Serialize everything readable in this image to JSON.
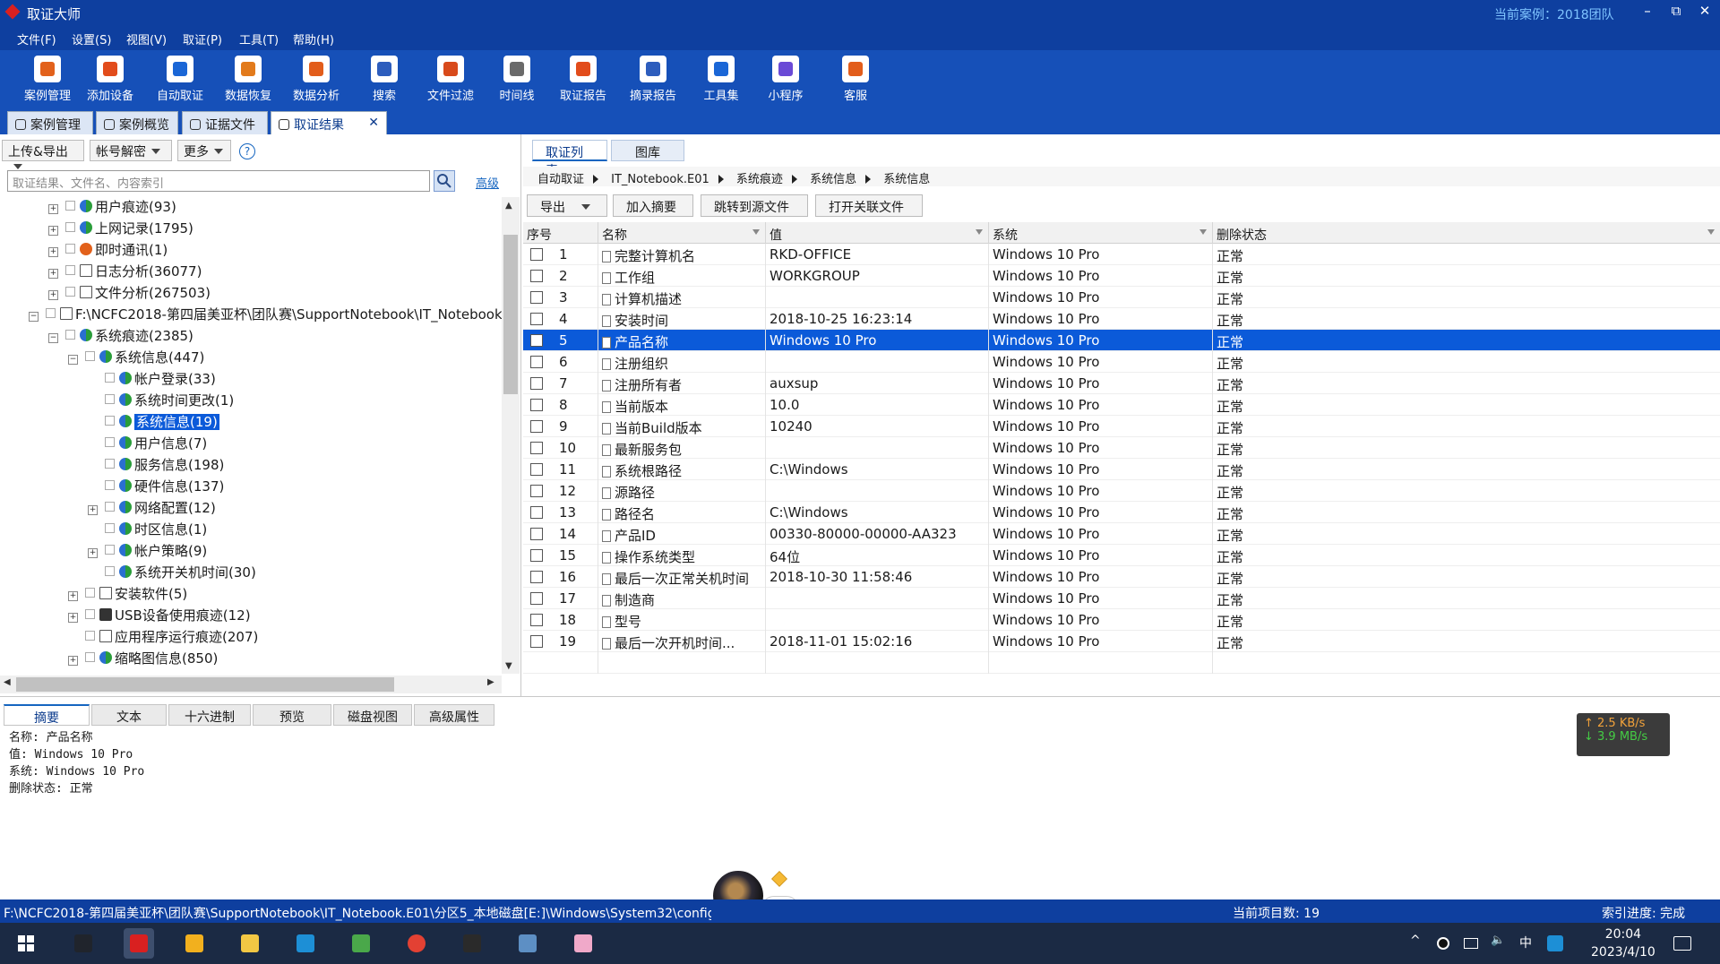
{
  "window": {
    "title": "取证大师",
    "current_case": "当前案例：2018团队",
    "controls": [
      "–",
      "⧉",
      "✕"
    ]
  },
  "menu": [
    "文件(F)",
    "设置(S)",
    "视图(V)",
    "取证(P)",
    "工具(T)",
    "帮助(H)"
  ],
  "toolbar": [
    {
      "label": "案例管理",
      "icon": "case-icon",
      "color": "#e2611b"
    },
    {
      "label": "添加设备",
      "icon": "add-device-icon",
      "color": "#e24c1b"
    },
    {
      "label": "自动取证",
      "icon": "auto-icon",
      "color": "#1a66d6"
    },
    {
      "label": "数据恢复",
      "icon": "recover-icon",
      "color": "#e27a1b"
    },
    {
      "label": "数据分析",
      "icon": "analysis-icon",
      "color": "#e25d1b"
    },
    {
      "label": "搜索",
      "icon": "search-doc-icon",
      "color": "#2d5dbd"
    },
    {
      "label": "文件过滤",
      "icon": "filter-icon",
      "color": "#d84a1b"
    },
    {
      "label": "时间线",
      "icon": "timeline-icon",
      "color": "#6a6a6a"
    },
    {
      "label": "取证报告",
      "icon": "report-icon",
      "color": "#e24c1b"
    },
    {
      "label": "摘录报告",
      "icon": "excerpt-icon",
      "color": "#2d5dbd"
    },
    {
      "label": "工具集",
      "icon": "tools-icon",
      "color": "#1a66d6"
    },
    {
      "label": "小程序",
      "icon": "miniprogram-icon",
      "color": "#6a4ad6"
    },
    {
      "label": "客服",
      "icon": "support-icon",
      "color": "#e25d1b"
    }
  ],
  "tabs": [
    {
      "label": "案例管理",
      "active": false
    },
    {
      "label": "案例概览",
      "active": false
    },
    {
      "label": "证据文件",
      "active": false
    },
    {
      "label": "取证结果",
      "active": true,
      "close": "✕"
    }
  ],
  "left": {
    "buttons": [
      "上传&导出",
      "帐号解密",
      "更多",
      "?"
    ],
    "search_placeholder": "取证结果、文件名、内容索引",
    "advanced": "高级",
    "tree": [
      {
        "label": "用户痕迹(93)",
        "level": 0,
        "exp": "+",
        "icon": "green"
      },
      {
        "label": "上网记录(1795)",
        "level": 0,
        "exp": "+",
        "icon": "globe"
      },
      {
        "label": "即时通讯(1)",
        "level": 0,
        "exp": "+",
        "icon": "chat"
      },
      {
        "label": "日志分析(36077)",
        "level": 0,
        "exp": "+",
        "icon": "doc"
      },
      {
        "label": "文件分析(267503)",
        "level": 0,
        "exp": "+",
        "icon": "doc"
      },
      {
        "label": "F:\\NCFC2018-第四届美亚杯\\团队赛\\SupportNotebook\\IT_Notebook.E01",
        "level": -1,
        "exp": "−",
        "icon": "doc"
      },
      {
        "label": "系统痕迹(2385)",
        "level": 0,
        "exp": "−",
        "icon": "green"
      },
      {
        "label": "系统信息(447)",
        "level": 1,
        "exp": "−",
        "icon": "green"
      },
      {
        "label": "帐户登录(33)",
        "level": 2,
        "exp": "",
        "icon": "green"
      },
      {
        "label": "系统时间更改(1)",
        "level": 2,
        "exp": "",
        "icon": "green"
      },
      {
        "label": "系统信息(19)",
        "level": 2,
        "exp": "",
        "icon": "green",
        "selected": true
      },
      {
        "label": "用户信息(7)",
        "level": 2,
        "exp": "",
        "icon": "green"
      },
      {
        "label": "服务信息(198)",
        "level": 2,
        "exp": "",
        "icon": "green"
      },
      {
        "label": "硬件信息(137)",
        "level": 2,
        "exp": "",
        "icon": "green"
      },
      {
        "label": "网络配置(12)",
        "level": 2,
        "exp": "+",
        "icon": "green"
      },
      {
        "label": "时区信息(1)",
        "level": 2,
        "exp": "",
        "icon": "green"
      },
      {
        "label": "帐户策略(9)",
        "level": 2,
        "exp": "+",
        "icon": "green"
      },
      {
        "label": "系统开关机时间(30)",
        "level": 2,
        "exp": "",
        "icon": "green"
      },
      {
        "label": "安装软件(5)",
        "level": 1,
        "exp": "+",
        "icon": "doc"
      },
      {
        "label": "USB设备使用痕迹(12)",
        "level": 1,
        "exp": "+",
        "icon": "usb"
      },
      {
        "label": "应用程序运行痕迹(207)",
        "level": 1,
        "exp": "",
        "icon": "doc"
      },
      {
        "label": "缩略图信息(850)",
        "level": 1,
        "exp": "+",
        "icon": "green"
      }
    ]
  },
  "right": {
    "tabs": [
      "取证列表",
      "图库"
    ],
    "breadcrumb": [
      "自动取证",
      "IT_Notebook.E01",
      "系统痕迹",
      "系统信息",
      "系统信息"
    ],
    "buttons": [
      "导出",
      "加入摘要",
      "跳转到源文件",
      "打开关联文件"
    ],
    "columns": [
      "序号",
      "名称",
      "值",
      "系统",
      "删除状态"
    ],
    "rows": [
      {
        "n": "1",
        "name": "完整计算机名",
        "value": "RKD-OFFICE",
        "sys": "Windows 10 Pro",
        "del": "正常"
      },
      {
        "n": "2",
        "name": "工作组",
        "value": "WORKGROUP",
        "sys": "Windows 10 Pro",
        "del": "正常"
      },
      {
        "n": "3",
        "name": "计算机描述",
        "value": "",
        "sys": "Windows 10 Pro",
        "del": "正常"
      },
      {
        "n": "4",
        "name": "安装时间",
        "value": "2018-10-25 16:23:14",
        "sys": "Windows 10 Pro",
        "del": "正常"
      },
      {
        "n": "5",
        "name": "产品名称",
        "value": "Windows 10 Pro",
        "sys": "Windows 10 Pro",
        "del": "正常",
        "selected": true
      },
      {
        "n": "6",
        "name": "注册组织",
        "value": "",
        "sys": "Windows 10 Pro",
        "del": "正常"
      },
      {
        "n": "7",
        "name": "注册所有者",
        "value": "auxsup",
        "sys": "Windows 10 Pro",
        "del": "正常"
      },
      {
        "n": "8",
        "name": "当前版本",
        "value": "10.0",
        "sys": "Windows 10 Pro",
        "del": "正常"
      },
      {
        "n": "9",
        "name": "当前Build版本",
        "value": "10240",
        "sys": "Windows 10 Pro",
        "del": "正常"
      },
      {
        "n": "10",
        "name": "最新服务包",
        "value": "",
        "sys": "Windows 10 Pro",
        "del": "正常"
      },
      {
        "n": "11",
        "name": "系统根路径",
        "value": "C:\\Windows",
        "sys": "Windows 10 Pro",
        "del": "正常"
      },
      {
        "n": "12",
        "name": "源路径",
        "value": "",
        "sys": "Windows 10 Pro",
        "del": "正常"
      },
      {
        "n": "13",
        "name": "路径名",
        "value": "C:\\Windows",
        "sys": "Windows 10 Pro",
        "del": "正常"
      },
      {
        "n": "14",
        "name": "产品ID",
        "value": "00330-80000-00000-AA323",
        "sys": "Windows 10 Pro",
        "del": "正常"
      },
      {
        "n": "15",
        "name": "操作系统类型",
        "value": "64位",
        "sys": "Windows 10 Pro",
        "del": "正常"
      },
      {
        "n": "16",
        "name": "最后一次正常关机时间",
        "value": "2018-10-30 11:58:46",
        "sys": "Windows 10 Pro",
        "del": "正常"
      },
      {
        "n": "17",
        "name": "制造商",
        "value": "",
        "sys": "Windows 10 Pro",
        "del": "正常"
      },
      {
        "n": "18",
        "name": "型号",
        "value": "",
        "sys": "Windows 10 Pro",
        "del": "正常"
      },
      {
        "n": "19",
        "name": "最后一次开机时间...",
        "value": "2018-11-01 15:02:16",
        "sys": "Windows 10 Pro",
        "del": "正常"
      }
    ]
  },
  "bottom": {
    "tabs": [
      "摘要",
      "文本",
      "十六进制",
      "预览",
      "磁盘视图",
      "高级属性"
    ],
    "summary": [
      "名称: 产品名称",
      "值: Windows 10 Pro",
      "系统: Windows 10 Pro",
      "删除状态: 正常"
    ],
    "net_up": "↑ 2.5 KB/s",
    "net_down": "↓ 3.9 MB/s",
    "ime": "英"
  },
  "status": {
    "path": "F:\\NCFC2018-第四届美亚杯\\团队赛\\SupportNotebook\\IT_Notebook.E01\\分区5_本地磁盘[E:]\\Windows\\System32\\config\\S...",
    "count": "当前项目数: 19",
    "index": "索引进度: 完成"
  },
  "taskbar": {
    "apps": [
      {
        "name": "windows-start-icon",
        "color": "#ffffff"
      },
      {
        "name": "app-pen-icon",
        "color": "#20242c"
      },
      {
        "name": "forensic-master-icon",
        "color": "#d92020"
      },
      {
        "name": "app-yellow-icon",
        "color": "#f2b01e"
      },
      {
        "name": "file-explorer-icon",
        "color": "#f2c744"
      },
      {
        "name": "app-blue-icon",
        "color": "#1d8fd6"
      },
      {
        "name": "app-green-icon",
        "color": "#4aa84a"
      },
      {
        "name": "chrome-icon",
        "color": "#e34133"
      },
      {
        "name": "terminal-icon",
        "color": "#2a2a2a"
      },
      {
        "name": "remote-desktop-icon",
        "color": "#5d8fc4"
      },
      {
        "name": "app-anime-icon",
        "color": "#f0a9c9"
      }
    ],
    "tray": [
      "^",
      "中"
    ],
    "time": "20:04",
    "date": "2023/4/10"
  }
}
